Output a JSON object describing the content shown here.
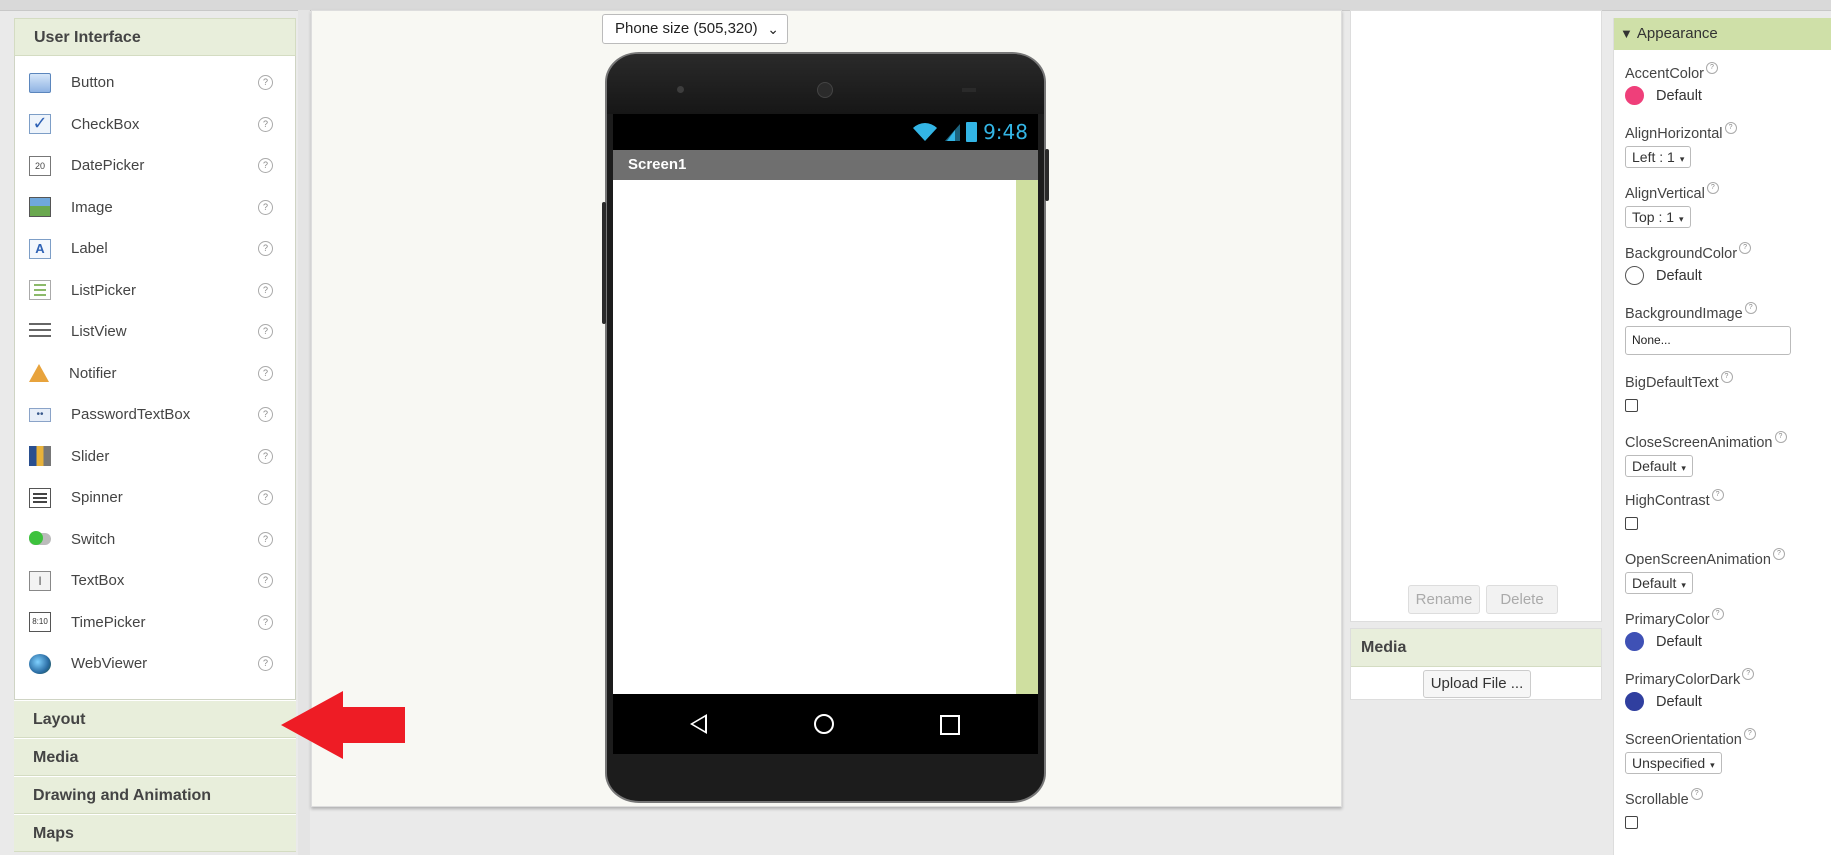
{
  "palette": {
    "header": "User Interface",
    "items": [
      {
        "label": "Button",
        "icon": "button-icon"
      },
      {
        "label": "CheckBox",
        "icon": "checkbox-icon"
      },
      {
        "label": "DatePicker",
        "icon": "datepicker-icon"
      },
      {
        "label": "Image",
        "icon": "image-icon"
      },
      {
        "label": "Label",
        "icon": "label-icon"
      },
      {
        "label": "ListPicker",
        "icon": "listpicker-icon"
      },
      {
        "label": "ListView",
        "icon": "listview-icon"
      },
      {
        "label": "Notifier",
        "icon": "notifier-icon"
      },
      {
        "label": "PasswordTextBox",
        "icon": "passwordtextbox-icon"
      },
      {
        "label": "Slider",
        "icon": "slider-icon"
      },
      {
        "label": "Spinner",
        "icon": "spinner-icon"
      },
      {
        "label": "Switch",
        "icon": "switch-icon"
      },
      {
        "label": "TextBox",
        "icon": "textbox-icon"
      },
      {
        "label": "TimePicker",
        "icon": "timepicker-icon"
      },
      {
        "label": "WebViewer",
        "icon": "webviewer-icon"
      }
    ],
    "help_glyph": "?",
    "date_icon_text": "20",
    "time_icon_text": "8:10",
    "label_icon_text": "A",
    "textbox_icon_text": "I",
    "password_icon_text": "••",
    "categories": [
      "Layout",
      "Media",
      "Drawing and Animation",
      "Maps"
    ]
  },
  "viewer": {
    "size_select": "Phone size (505,320)",
    "size_select_chevron": "⌄",
    "status_time": "9:48",
    "screen_title": "Screen1"
  },
  "components": {
    "rename_label": "Rename",
    "delete_label": "Delete"
  },
  "media": {
    "header": "Media",
    "upload_label": "Upload File ..."
  },
  "properties": {
    "header": "Appearance",
    "header_glyph": "▼",
    "help_glyph": "?",
    "caret": "▾",
    "accent_color": {
      "name": "AccentColor",
      "value": "Default",
      "color": "#ef3f7a"
    },
    "align_horizontal": {
      "name": "AlignHorizontal",
      "value": "Left : 1"
    },
    "align_vertical": {
      "name": "AlignVertical",
      "value": "Top : 1"
    },
    "background_color": {
      "name": "BackgroundColor",
      "value": "Default",
      "color": "#ffffff"
    },
    "background_image": {
      "name": "BackgroundImage",
      "value": "None..."
    },
    "big_default_text": {
      "name": "BigDefaultText"
    },
    "close_screen_animation": {
      "name": "CloseScreenAnimation",
      "value": "Default"
    },
    "high_contrast": {
      "name": "HighContrast"
    },
    "open_screen_animation": {
      "name": "OpenScreenAnimation",
      "value": "Default"
    },
    "primary_color": {
      "name": "PrimaryColor",
      "value": "Default",
      "color": "#3f51b5"
    },
    "primary_color_dark": {
      "name": "PrimaryColorDark",
      "value": "Default",
      "color": "#303f9f"
    },
    "screen_orientation": {
      "name": "ScreenOrientation",
      "value": "Unspecified"
    },
    "scrollable": {
      "name": "Scrollable"
    }
  },
  "colors": {
    "arrow": "#ee1c25",
    "status_icons": "#33b5e5",
    "category_bg": "#e8eedb",
    "appearance_bg": "#cfe0a8"
  }
}
